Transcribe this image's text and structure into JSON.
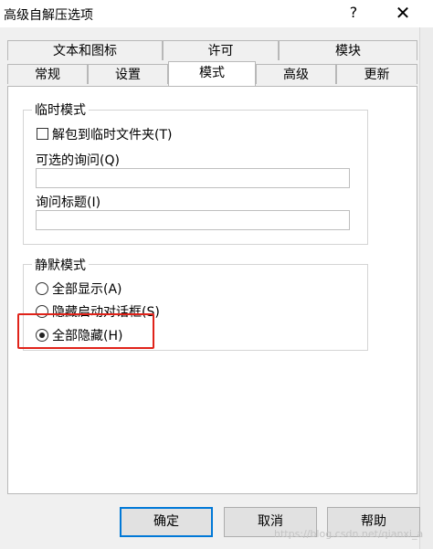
{
  "window": {
    "title": "高级自解压选项",
    "help_glyph": "?",
    "close_glyph": "✕"
  },
  "tabs": {
    "row1": [
      "文本和图标",
      "许可",
      "模块"
    ],
    "row2": [
      "常规",
      "设置",
      "模式",
      "高级",
      "更新"
    ],
    "active": "模式"
  },
  "temp_mode": {
    "label": "临时模式",
    "unpack_checkbox_label": "解包到临时文件夹(T)",
    "unpack_checked": false,
    "optional_query_label": "可选的询问(Q)",
    "optional_query_value": "",
    "query_title_label": "询问标题(I)",
    "query_title_value": ""
  },
  "silent_mode": {
    "label": "静默模式",
    "options": [
      "全部显示(A)",
      "隐藏启动对话框(S)",
      "全部隐藏(H)"
    ],
    "selected": "全部隐藏(H)"
  },
  "buttons": {
    "ok": "确定",
    "cancel": "取消",
    "help": "帮助"
  },
  "watermark": "https://blog.csdn.net/qianxi_a"
}
